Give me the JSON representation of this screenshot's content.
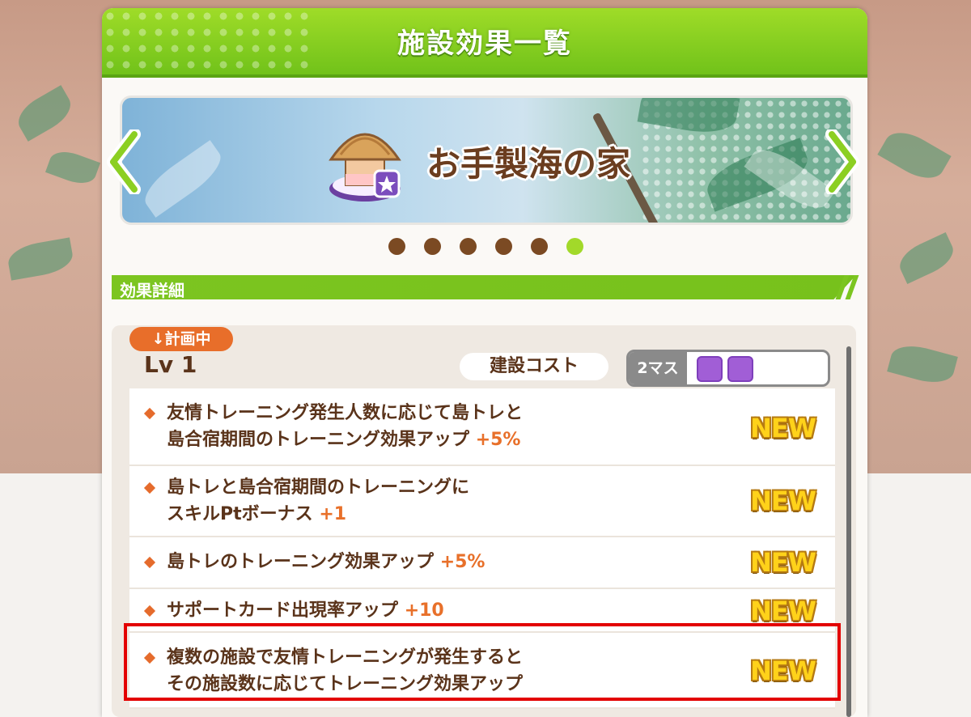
{
  "modal": {
    "title": "施設効果一覧"
  },
  "banner": {
    "facility_name": "お手製海の家",
    "icon": "beach-hut-icon",
    "pagination": {
      "total": 6,
      "active_index": 5
    }
  },
  "section": {
    "title": "効果詳細"
  },
  "level_panel": {
    "status_badge": "↓計画中",
    "level": "Lv 1",
    "cost_label": "建設コスト",
    "cost_count": "2マス",
    "cost_slots": 2
  },
  "effects": [
    {
      "line1": "友情トレーニング発生人数に応じて島トレと",
      "line2": "島合宿期間のトレーニング効果アップ",
      "bonus": "+5%",
      "badge": "NEW"
    },
    {
      "line1": "島トレと島合宿期間のトレーニングに",
      "line2": "スキルPtボーナス",
      "bonus": "+1",
      "badge": "NEW"
    },
    {
      "line1": "島トレのトレーニング効果アップ",
      "line2": "",
      "bonus": "+5%",
      "badge": "NEW"
    },
    {
      "line1": "サポートカード出現率アップ",
      "line2": "",
      "bonus": "+10",
      "badge": "NEW"
    },
    {
      "line1": "複数の施設で友情トレーニングが発生すると",
      "line2": "その施設数に応じてトレーニング効果アップ",
      "bonus": "",
      "badge": "NEW"
    }
  ],
  "colors": {
    "header_green": "#7cc520",
    "accent_orange": "#e86e2a",
    "text_brown": "#5a331a",
    "slot_purple": "#a15ed6",
    "highlight_red": "#e30000"
  }
}
